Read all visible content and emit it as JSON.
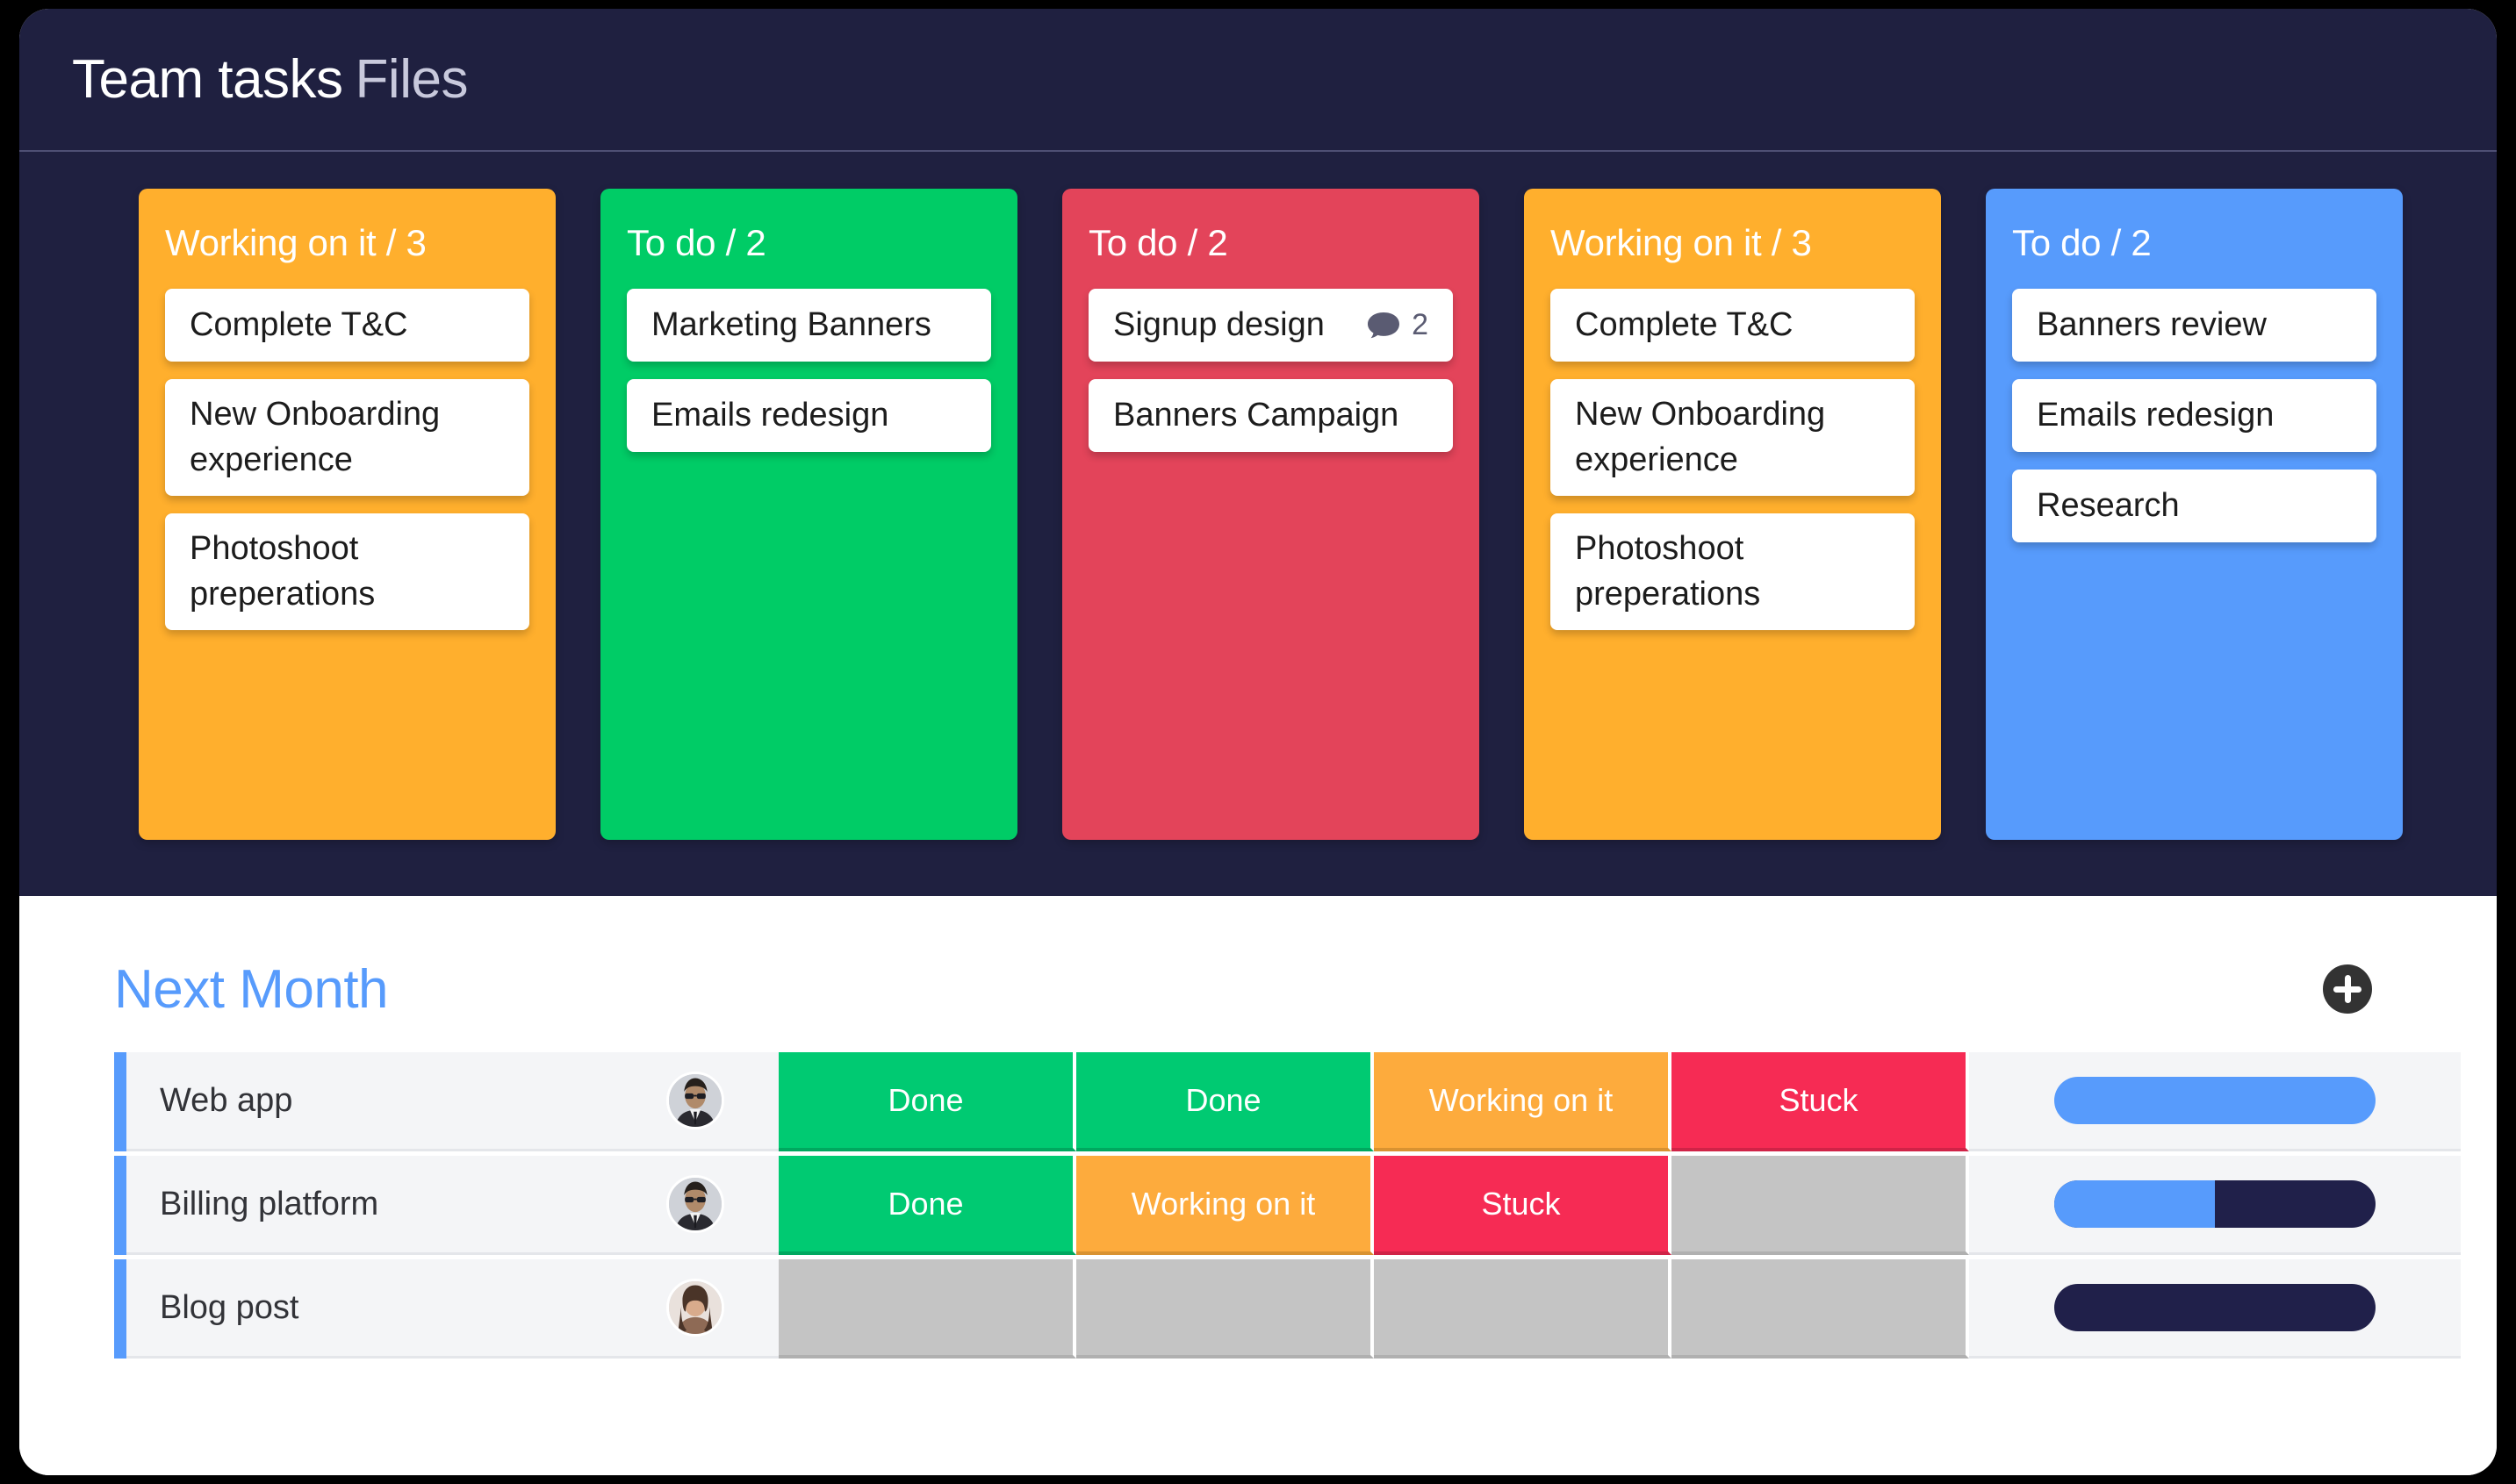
{
  "window": {
    "background_color": "#000000",
    "card_color": "#ffffff"
  },
  "board": {
    "background_color": "#1F2040",
    "title_main": "Team tasks",
    "title_sub": "Files",
    "columns": [
      {
        "name": "column-working-on-it-orange",
        "title": "Working on it / 3",
        "color": "#FFAF2D",
        "cards": [
          {
            "text": "Complete T&C",
            "comments": null
          },
          {
            "text": "New Onboarding experience",
            "comments": null
          },
          {
            "text": "Photoshoot preperations",
            "comments": null
          }
        ]
      },
      {
        "name": "column-to-do-green",
        "title": "To do / 2",
        "color": "#00CC66",
        "cards": [
          {
            "text": "Marketing Banners",
            "comments": null
          },
          {
            "text": "Emails redesign",
            "comments": null
          }
        ]
      },
      {
        "name": "column-to-do-red",
        "title": "To do / 2",
        "color": "#E3445A",
        "cards": [
          {
            "text": "Signup design",
            "comments": "2"
          },
          {
            "text": "Banners Campaign",
            "comments": null
          }
        ]
      },
      {
        "name": "column-working-on-it-orange-2",
        "title": "Working on it / 3",
        "color": "#FFAF2D",
        "cards": [
          {
            "text": "Complete T&C",
            "comments": null
          },
          {
            "text": "New Onboarding experience",
            "comments": null
          },
          {
            "text": "Photoshoot preperations",
            "comments": null
          }
        ]
      },
      {
        "name": "column-to-do-blue",
        "title": "To do / 2",
        "color": "#579BFC",
        "cards": [
          {
            "text": "Banners review",
            "comments": null
          },
          {
            "text": "Emails redesign",
            "comments": null
          },
          {
            "text": "Research",
            "comments": null
          }
        ]
      }
    ]
  },
  "lower": {
    "section_title": "Next Month",
    "section_title_color": "#579BFC",
    "add_button_icon": "plus-icon",
    "statuses": {
      "done": {
        "label": "Done",
        "color": "#00CA72"
      },
      "working": {
        "label": "Working on it",
        "color": "#FDAB3D"
      },
      "stuck": {
        "label": "Stuck",
        "color": "#F62B54"
      },
      "empty": {
        "label": "",
        "color": "#C4C4C4"
      }
    },
    "rows": [
      {
        "name": "Web app",
        "avatar": "avatar-man-sunglasses",
        "cells": [
          "done",
          "done",
          "working",
          "stuck"
        ],
        "progress_percent": 100
      },
      {
        "name": "Billing platform",
        "avatar": "avatar-man-sunglasses",
        "cells": [
          "done",
          "working",
          "stuck",
          "empty"
        ],
        "progress_percent": 50
      },
      {
        "name": "Blog post",
        "avatar": "avatar-woman",
        "cells": [
          "empty",
          "empty",
          "empty",
          "empty"
        ],
        "progress_percent": 0
      }
    ]
  }
}
